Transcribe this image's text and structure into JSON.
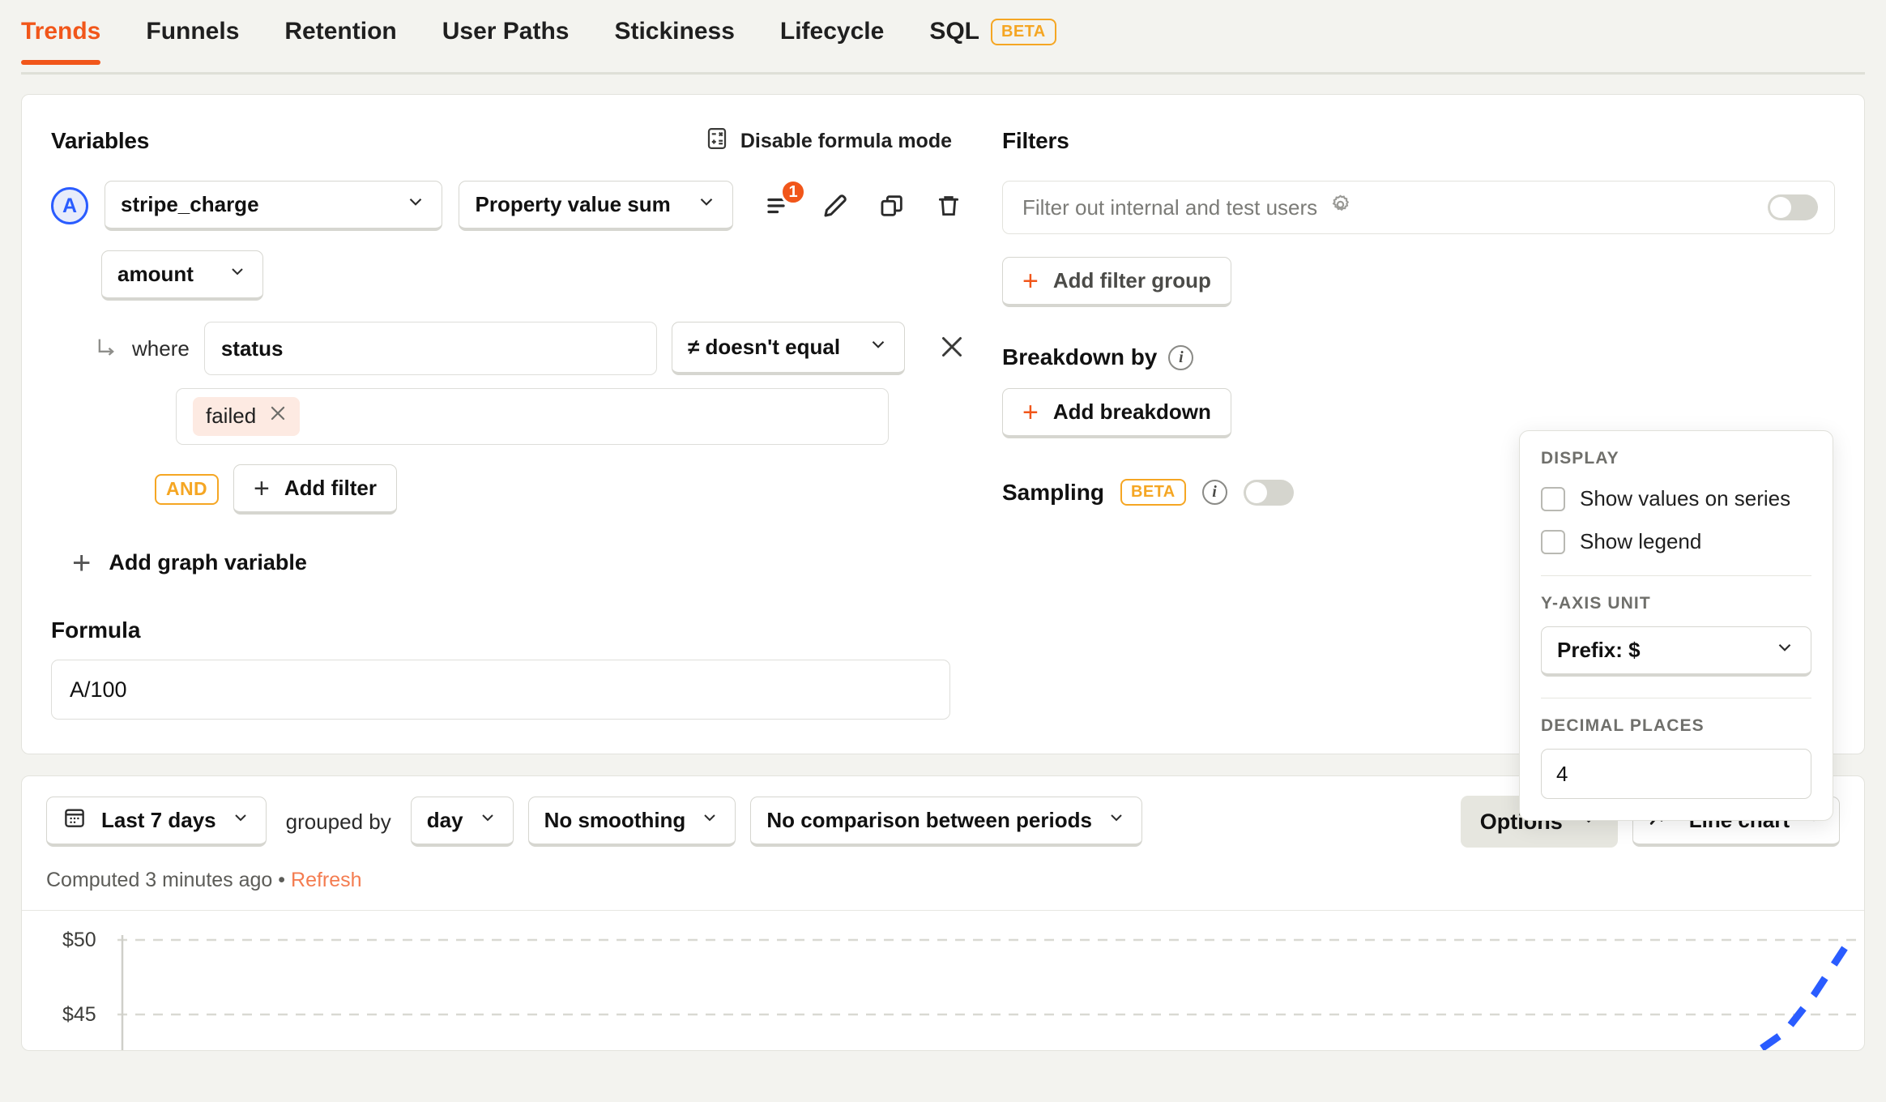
{
  "tabs": [
    {
      "label": "Trends",
      "active": true
    },
    {
      "label": "Funnels",
      "active": false
    },
    {
      "label": "Retention",
      "active": false
    },
    {
      "label": "User Paths",
      "active": false
    },
    {
      "label": "Stickiness",
      "active": false
    },
    {
      "label": "Lifecycle",
      "active": false
    },
    {
      "label": "SQL",
      "active": false,
      "badge": "BETA"
    }
  ],
  "variables": {
    "title": "Variables",
    "formula_mode_label": "Disable formula mode",
    "series_badge": "A",
    "event_name": "stripe_charge",
    "math": "Property value sum",
    "filter_count": "1",
    "property": "amount",
    "where_label": "where",
    "filter_key": "status",
    "filter_operator": "≠ doesn't equal",
    "filter_value": "failed",
    "and_label": "AND",
    "add_filter_label": "Add filter",
    "add_graph_variable_label": "Add graph variable"
  },
  "formula": {
    "title": "Formula",
    "value": "A/100"
  },
  "filters": {
    "title": "Filters",
    "internal_users_label": "Filter out internal and test users",
    "internal_users_enabled": false,
    "add_filter_group_label": "Add filter group"
  },
  "breakdown": {
    "title": "Breakdown by",
    "add_breakdown_label": "Add breakdown"
  },
  "sampling": {
    "title": "Sampling",
    "badge": "BETA",
    "enabled": false
  },
  "options_popover": {
    "display_label": "DISPLAY",
    "show_values_label": "Show values on series",
    "show_values_checked": false,
    "show_legend_label": "Show legend",
    "show_legend_checked": false,
    "y_axis_unit_label": "Y-AXIS UNIT",
    "y_axis_unit_value": "Prefix: $",
    "decimal_places_label": "DECIMAL PLACES",
    "decimal_places_value": "4"
  },
  "toolbar": {
    "date_range": "Last 7 days",
    "grouped_by_label": "grouped by",
    "interval": "day",
    "smoothing": "No smoothing",
    "comparison": "No comparison between periods",
    "options_label": "Options",
    "chart_type": "Line chart"
  },
  "status": {
    "computed_text": "Computed 3 minutes ago",
    "separator": "•",
    "refresh_label": "Refresh"
  },
  "colors": {
    "accent": "#f1561a",
    "beta": "#f5a623",
    "series_blue": "#2a5cff",
    "tag_bg": "#fdeae2"
  },
  "chart_data": {
    "type": "line",
    "title": "",
    "xlabel": "",
    "ylabel": "",
    "yticks": [
      "$50",
      "$45"
    ],
    "ytick_values": [
      50,
      45
    ],
    "ylim": [
      40,
      52
    ],
    "grid": true,
    "legend": false,
    "series": [
      {
        "name": "A",
        "color": "#2a5cff",
        "style": "dashed",
        "x": [
          0,
          1,
          2,
          3,
          4,
          5,
          6
        ],
        "values": [
          null,
          null,
          null,
          null,
          42.0,
          45.5,
          49.5
        ]
      }
    ]
  }
}
